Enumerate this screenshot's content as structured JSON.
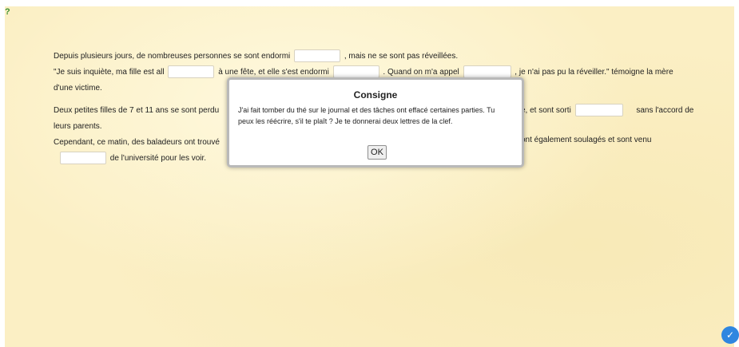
{
  "icons": {
    "corner": "question-icon",
    "fab": "edit-check-icon"
  },
  "text": {
    "line1_a": "Depuis plusieurs jours, de nombreuses personnes se sont endormi",
    "line1_b": ", mais ne se sont pas réveillées.",
    "line2_a": "\"Je suis inquiète, ma fille est all",
    "line2_b": "à une fête, et elle s'est endormi",
    "line2_c": ". Quand on m'a appel",
    "line2_d": ", je n'ai pas pu la réveiller.\" témoigne la mère",
    "line3": "d'une victime.",
    "line4_a": "Deux petites filles de 7 et 11 ans se sont perdu",
    "line4_b": "e, et sont sorti",
    "line4_c": "sans l'accord de",
    "line5": "leurs parents.",
    "line6_a": "Cependant, ce matin, des baladeurs ont trouvé",
    "line6_b": "ont également soulagés et sont venu",
    "line7": "de l'université pour les voir."
  },
  "dialog": {
    "title": "Consigne",
    "body": "J'ai fait tomber du thé sur le journal et des tâches ont effacé certaines parties. Tu peux les réécrire, s'il te plaît ? Je te donnerai deux lettres de la clef.",
    "ok_label": "OK"
  }
}
